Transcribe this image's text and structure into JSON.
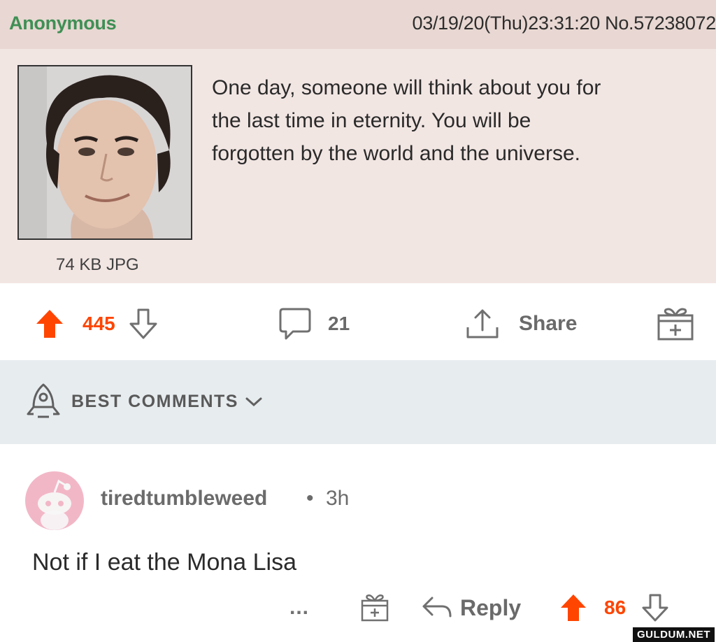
{
  "post": {
    "poster_name": "Anonymous",
    "post_meta": "03/19/20(Thu)23:31:20 No.57238072",
    "text_lines": [
      "One day, someone will think about you for",
      "the last time in eternity. You will be",
      "forgotten by the world and the universe."
    ],
    "image_info": "74 KB JPG"
  },
  "actions": {
    "upvotes": "445",
    "comments_count": "21",
    "share_label": "Share"
  },
  "sort": {
    "label": "BEST COMMENTS"
  },
  "comment": {
    "username": "tiredtumbleweed",
    "separator": "•",
    "age": "3h",
    "text": "Not if I eat the Mona Lisa",
    "more_label": "...",
    "reply_label": "Reply",
    "votes": "86"
  },
  "watermark": "GULDUM.NET",
  "colors": {
    "upvote": "#ff4500",
    "poster_green": "#3f8f55",
    "post_background": "#f2e6e3",
    "post_header": "#e8d7d2",
    "band": "#e7ecef",
    "avatar_bg": "#f2b7c7"
  },
  "icons": [
    "upvote-arrow-icon",
    "downvote-arrow-icon",
    "comment-bubble-icon",
    "share-icon",
    "award-gift-icon",
    "rocket-icon",
    "chevron-down-icon",
    "reply-arrow-icon",
    "snoo-avatar-icon"
  ]
}
